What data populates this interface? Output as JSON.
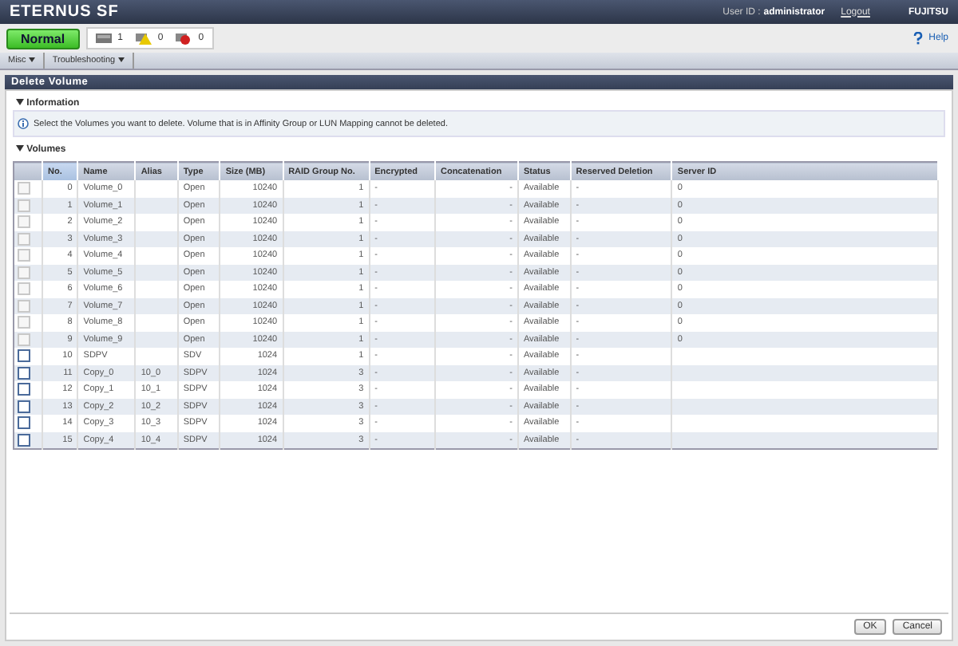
{
  "header": {
    "product": "ETERNUS SF",
    "user_label": "User ID :",
    "user": "administrator",
    "logout": "Logout",
    "vendor": "FUJITSU"
  },
  "status": {
    "state": "Normal",
    "counters": [
      {
        "kind": "info",
        "count": "1"
      },
      {
        "kind": "warning",
        "count": "0"
      },
      {
        "kind": "error",
        "count": "0"
      }
    ],
    "help": "Help"
  },
  "menu": [
    "Misc",
    "Troubleshooting"
  ],
  "page_title": "Delete Volume",
  "information": {
    "title": "Information",
    "message": "Select the Volumes you want to delete. Volume that is in Affinity Group or LUN Mapping cannot be deleted."
  },
  "volumes": {
    "title": "Volumes",
    "columns": [
      "No.",
      "Name",
      "Alias",
      "Type",
      "Size (MB)",
      "RAID Group No.",
      "Encrypted",
      "Concatenation",
      "Status",
      "Reserved Deletion",
      "Server ID"
    ],
    "rows": [
      {
        "disabled": true,
        "cells": [
          "0",
          "Volume_0",
          "",
          "Open",
          "10240",
          "1",
          "-",
          "-",
          "Available",
          "-",
          "0"
        ]
      },
      {
        "disabled": true,
        "cells": [
          "1",
          "Volume_1",
          "",
          "Open",
          "10240",
          "1",
          "-",
          "-",
          "Available",
          "-",
          "0"
        ]
      },
      {
        "disabled": true,
        "cells": [
          "2",
          "Volume_2",
          "",
          "Open",
          "10240",
          "1",
          "-",
          "-",
          "Available",
          "-",
          "0"
        ]
      },
      {
        "disabled": true,
        "cells": [
          "3",
          "Volume_3",
          "",
          "Open",
          "10240",
          "1",
          "-",
          "-",
          "Available",
          "-",
          "0"
        ]
      },
      {
        "disabled": true,
        "cells": [
          "4",
          "Volume_4",
          "",
          "Open",
          "10240",
          "1",
          "-",
          "-",
          "Available",
          "-",
          "0"
        ]
      },
      {
        "disabled": true,
        "cells": [
          "5",
          "Volume_5",
          "",
          "Open",
          "10240",
          "1",
          "-",
          "-",
          "Available",
          "-",
          "0"
        ]
      },
      {
        "disabled": true,
        "cells": [
          "6",
          "Volume_6",
          "",
          "Open",
          "10240",
          "1",
          "-",
          "-",
          "Available",
          "-",
          "0"
        ]
      },
      {
        "disabled": true,
        "cells": [
          "7",
          "Volume_7",
          "",
          "Open",
          "10240",
          "1",
          "-",
          "-",
          "Available",
          "-",
          "0"
        ]
      },
      {
        "disabled": true,
        "cells": [
          "8",
          "Volume_8",
          "",
          "Open",
          "10240",
          "1",
          "-",
          "-",
          "Available",
          "-",
          "0"
        ]
      },
      {
        "disabled": true,
        "cells": [
          "9",
          "Volume_9",
          "",
          "Open",
          "10240",
          "1",
          "-",
          "-",
          "Available",
          "-",
          "0"
        ]
      },
      {
        "disabled": false,
        "cells": [
          "10",
          "SDPV",
          "",
          "SDV",
          "1024",
          "1",
          "-",
          "-",
          "Available",
          "-",
          ""
        ]
      },
      {
        "disabled": false,
        "cells": [
          "11",
          "Copy_0",
          "10_0",
          "SDPV",
          "1024",
          "3",
          "-",
          "-",
          "Available",
          "-",
          ""
        ]
      },
      {
        "disabled": false,
        "cells": [
          "12",
          "Copy_1",
          "10_1",
          "SDPV",
          "1024",
          "3",
          "-",
          "-",
          "Available",
          "-",
          ""
        ]
      },
      {
        "disabled": false,
        "cells": [
          "13",
          "Copy_2",
          "10_2",
          "SDPV",
          "1024",
          "3",
          "-",
          "-",
          "Available",
          "-",
          ""
        ]
      },
      {
        "disabled": false,
        "cells": [
          "14",
          "Copy_3",
          "10_3",
          "SDPV",
          "1024",
          "3",
          "-",
          "-",
          "Available",
          "-",
          ""
        ]
      },
      {
        "disabled": false,
        "cells": [
          "15",
          "Copy_4",
          "10_4",
          "SDPV",
          "1024",
          "3",
          "-",
          "-",
          "Available",
          "-",
          ""
        ]
      }
    ]
  },
  "buttons": [
    "OK",
    "Cancel"
  ]
}
